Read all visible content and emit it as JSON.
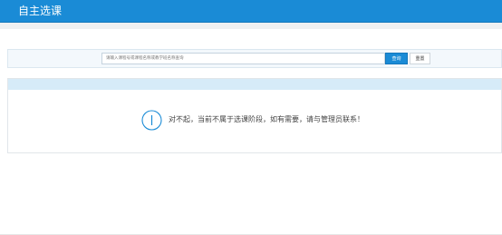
{
  "header": {
    "title": "自主选课"
  },
  "search": {
    "placeholder": "请输入课程号或课程名称或教学班名称查询",
    "query_label": "查询",
    "reset_label": "重置"
  },
  "notice": {
    "icon": "info-circle-icon",
    "message": "对不起，当前不属于选课阶段，如有需要，请与管理员联系！"
  },
  "colors": {
    "brand": "#1a8bd6",
    "panel_header": "#d6ebf8"
  }
}
